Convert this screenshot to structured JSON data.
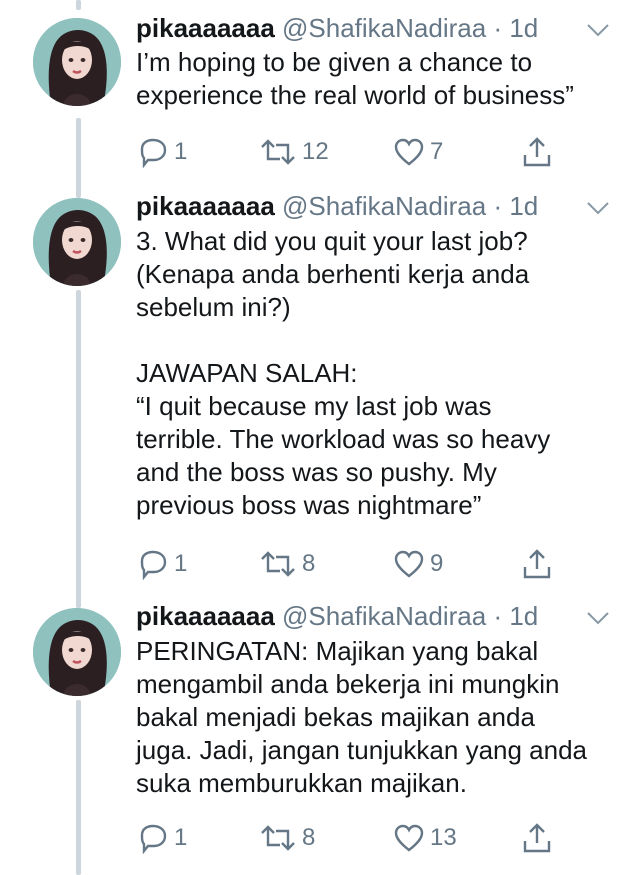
{
  "tweets": [
    {
      "name": "pikaaaaaaa",
      "handle": "@ShafikaNadiraa",
      "time": "· 1d",
      "text": "I’m hoping to be given a chance to experience the real world of business”",
      "replies": "1",
      "retweets": "12",
      "likes": "7"
    },
    {
      "name": "pikaaaaaaa",
      "handle": "@ShafikaNadiraa",
      "time": "· 1d",
      "text": "3. What did you quit your last job?\n(Kenapa anda berhenti kerja anda\nsebelum ini?)\n\nJAWAPAN SALAH:\n“I quit because my last job was\nterrible. The workload was so heavy\nand the boss was so pushy. My\nprevious boss was nightmare”",
      "replies": "1",
      "retweets": "8",
      "likes": "9"
    },
    {
      "name": "pikaaaaaaa",
      "handle": "@ShafikaNadiraa",
      "time": "· 1d",
      "text": "PERINGATAN: Majikan yang bakal\nmengambil anda bekerja ini mungkin\nbakal menjadi bekas majikan anda\njuga. Jadi, jangan tunjukkan yang anda\nsuka memburukkan majikan.",
      "replies": "1",
      "retweets": "8",
      "likes": "13"
    }
  ],
  "icons": {
    "reply": "reply-icon",
    "retweet": "retweet-icon",
    "like": "heart-icon",
    "share": "share-icon",
    "menu": "chevron-down-icon"
  },
  "colors": {
    "text": "#14171a",
    "secondary": "#657786",
    "thread_line": "#cdd6dd"
  }
}
